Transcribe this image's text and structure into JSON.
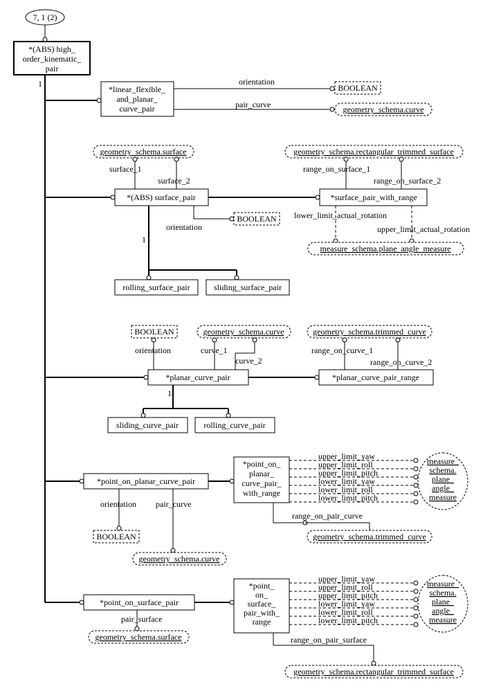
{
  "pageRef": "7, 1 (2)",
  "root": "*(ABS) high_ order_kinematic_ pair",
  "types": {
    "boolean": "BOOLEAN",
    "gsCurve": "geometry_schema.curve",
    "gsSurface": "geometry_schema.surface",
    "gsRectTrim": "geometry_schema.rectangular_trimmed_surface",
    "gsTrimCurve": "geometry_schema.trimmed_curve",
    "msPlaneAngle": "measure_schema.plane_angle_measure",
    "msPlaneAngleMulti": "measure_ schema. plane_ angle_ measure"
  },
  "entities": {
    "linearFlexible": "*linear_flexible_ and_planar_ curve_pair",
    "surfacePair": "*(ABS) surface_pair",
    "surfacePairRange": "*surface_pair_with_range",
    "rollingSurface": "rolling_surface_pair",
    "slidingSurface": "sliding_surface_pair",
    "planarCurvePair": "*planar_curve_pair",
    "planarCurvePairRange": "*planar_curve_pair_range",
    "slidingCurve": "sliding_curve_pair",
    "rollingCurve": "rolling_curve_pair",
    "pointOnPlanarCurve": "*point_on_planar_curve_pair",
    "pointOnPlanarCurveRange": "*point_on_ planar_ curve_pair_ with_range",
    "pointOnSurface": "*point_on_surface_pair",
    "pointOnSurfaceRange": "*point_ on_ surface_ pair_with_ range"
  },
  "attrs": {
    "orientation": "orientation",
    "pairCurve": "pair_curve",
    "surface1": "surface_1",
    "surface2": "surface_2",
    "rangeOnSurface1": "range_on_surface_1",
    "rangeOnSurface2": "range_on_surface_2",
    "lowerLimitActualRotation": "lower_limit_actual_rotation",
    "upperLimitActualRotation": "upper_limit_actual_rotation",
    "curve1": "curve_1",
    "curve2": "curve_2",
    "rangeOnCurve1": "range_on_curve_1",
    "rangeOnCurve2": "range_on_curve_2",
    "upperLimitYaw": "upper_limit_yaw",
    "upperLimitRoll": "upper_limit_roll",
    "upperLimitPitch": "upper_limit_pitch",
    "lowerLimitYaw": "lower_limit_yaw",
    "lowerLimitRoll": "lower_limit_roll",
    "lowerLimitPitch": "lower_limit_pitch",
    "rangeOnPairCurve": "range_on_pair_curve",
    "pairSurface": "pair_surface",
    "rangeOnPairSurface": "range_on_pair_surface"
  },
  "one": "1"
}
